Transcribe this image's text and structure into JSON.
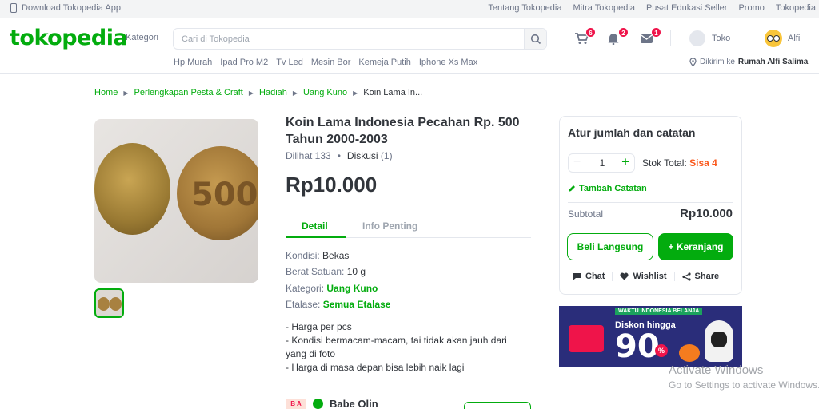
{
  "topbar": {
    "download": "Download Tokopedia App",
    "links": [
      "Tentang Tokopedia",
      "Mitra Tokopedia",
      "Pusat Edukasi Seller",
      "Promo",
      "Tokopedia"
    ]
  },
  "header": {
    "logo": "tokopedia",
    "kategori": "Kategori",
    "search_placeholder": "Cari di Tokopedia",
    "cart_count": "6",
    "notif_count": "2",
    "message_count": "1",
    "toko": "Toko",
    "user": "Alfi",
    "keywords": [
      "Hp Murah",
      "Ipad Pro M2",
      "Tv Led",
      "Mesin Bor",
      "Kemeja Putih",
      "Iphone Xs Max"
    ],
    "location_prefix": "Dikirim ke",
    "location_name": "Rumah Alfi Salima"
  },
  "breadcrumb": [
    "Home",
    "Perlengkapan Pesta & Craft",
    "Hadiah",
    "Uang Kuno",
    "Koin Lama In..."
  ],
  "product": {
    "title": "Koin Lama Indonesia Pecahan Rp. 500 Tahun 2000-2003",
    "views": "Dilihat 133",
    "discussion_label": "Diskusi",
    "discussion_count": "(1)",
    "price": "Rp10.000",
    "tabs": [
      "Detail",
      "Info Penting"
    ],
    "specs": {
      "kondisi_k": "Kondisi:",
      "kondisi_v": "Bekas",
      "berat_k": "Berat Satuan:",
      "berat_v": "10 g",
      "kategori_k": "Kategori:",
      "kategori_v": "Uang Kuno",
      "etalase_k": "Etalase:",
      "etalase_v": "Semua Etalase"
    },
    "description": [
      "- Harga per pcs",
      "- Kondisi bermacam-macam, tai tidak akan jauh dari yang di foto",
      "- Harga di masa depan bisa lebih naik lagi"
    ],
    "coin_text": "500"
  },
  "seller": {
    "avatar": "B A",
    "name": "Babe Olin"
  },
  "card": {
    "title": "Atur jumlah dan catatan",
    "qty": "1",
    "stok_label": "Stok Total:",
    "stok_value": "Sisa 4",
    "add_note": "Tambah Catatan",
    "subtotal_label": "Subtotal",
    "subtotal_value": "Rp10.000",
    "buy_now": "Beli Langsung",
    "add_cart": "+ Keranjang",
    "chat": "Chat",
    "wishlist": "Wishlist",
    "share": "Share"
  },
  "banner": {
    "strip": "WAKTU INDONESIA BELANJA",
    "discount": "Diskon hingga",
    "value": "90",
    "percent": "%"
  },
  "watermark": {
    "line1": "Activate Windows",
    "line2": "Go to Settings to activate Windows."
  }
}
